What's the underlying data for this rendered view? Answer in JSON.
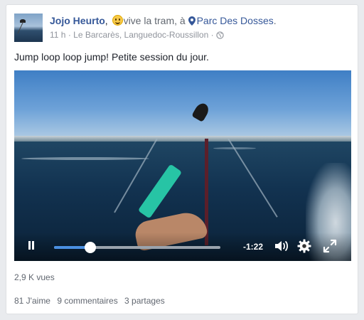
{
  "post": {
    "author": "Jojo Heurto",
    "comma": ",",
    "activity": "vive la tram, à",
    "place": "Parc Des Dosses",
    "period": ".",
    "time": "11 h",
    "separator": "·",
    "location": "Le Barcarès, Languedoc-Roussillon",
    "text": "Jump loop loop jump! Petite session du jour."
  },
  "video": {
    "time_remaining": "-1:22",
    "progress": 0.22,
    "icons": [
      "pause-icon",
      "volume-icon",
      "gear-icon",
      "fullscreen-icon"
    ]
  },
  "footer": {
    "views": "2,9 K vues",
    "likes": "81 J'aime",
    "comments": "9 commentaires",
    "shares": "3 partages"
  },
  "colors": {
    "link": "#365899",
    "progress": "#4a90e2",
    "muted": "#90949c"
  }
}
